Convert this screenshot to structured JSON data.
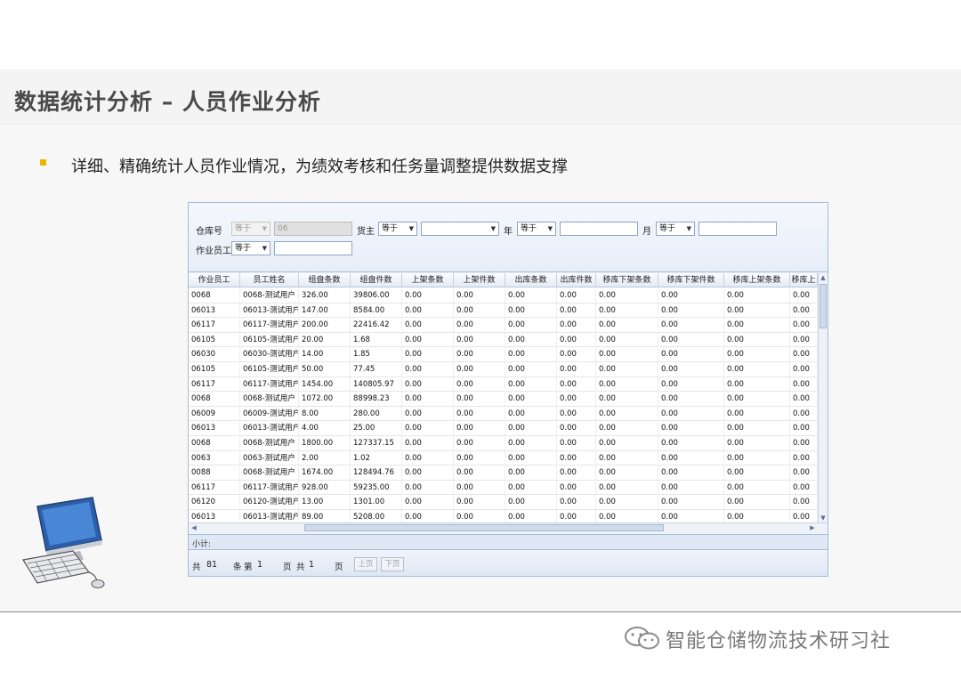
{
  "slide": {
    "title": "数据统计分析 – 人员作业分析",
    "bullet": "详细、精确统计人员作业情况，为绩效考核和任务量调整提供数据支撑",
    "accent_color": "#f0b400"
  },
  "filters": {
    "warehouse_label": "仓库号",
    "warehouse_op": "等于",
    "warehouse_value": "06",
    "owner_label": "货主",
    "owner_op": "等于",
    "owner_value": "",
    "year_label": "年",
    "year_op": "等于",
    "year_value": "",
    "month_label": "月",
    "month_op": "等于",
    "month_value": "",
    "worker_label": "作业员工",
    "worker_op": "等于",
    "worker_value": ""
  },
  "grid": {
    "columns": [
      "作业员工",
      "员工姓名",
      "组盘条数",
      "组盘件数",
      "上架条数",
      "上架件数",
      "出库条数",
      "出库件数",
      "移库下架条数",
      "移库下架件数",
      "移库上架条数",
      "移库上"
    ],
    "rows": [
      [
        "0068",
        "0068-测试用户",
        "326.00",
        "39806.00",
        "0.00",
        "0.00",
        "0.00",
        "0.00",
        "0.00",
        "0.00",
        "0.00",
        "0.00"
      ],
      [
        "06013",
        "06013-测试用户",
        "147.00",
        "8584.00",
        "0.00",
        "0.00",
        "0.00",
        "0.00",
        "0.00",
        "0.00",
        "0.00",
        "0.00"
      ],
      [
        "06117",
        "06117-测试用户",
        "200.00",
        "22416.42",
        "0.00",
        "0.00",
        "0.00",
        "0.00",
        "0.00",
        "0.00",
        "0.00",
        "0.00"
      ],
      [
        "06105",
        "06105-测试用户",
        "20.00",
        "1.68",
        "0.00",
        "0.00",
        "0.00",
        "0.00",
        "0.00",
        "0.00",
        "0.00",
        "0.00"
      ],
      [
        "06030",
        "06030-测试用户",
        "14.00",
        "1.85",
        "0.00",
        "0.00",
        "0.00",
        "0.00",
        "0.00",
        "0.00",
        "0.00",
        "0.00"
      ],
      [
        "06105",
        "06105-测试用户",
        "50.00",
        "77.45",
        "0.00",
        "0.00",
        "0.00",
        "0.00",
        "0.00",
        "0.00",
        "0.00",
        "0.00"
      ],
      [
        "06117",
        "06117-测试用户",
        "1454.00",
        "140805.97",
        "0.00",
        "0.00",
        "0.00",
        "0.00",
        "0.00",
        "0.00",
        "0.00",
        "0.00"
      ],
      [
        "0068",
        "0068-测试用户",
        "1072.00",
        "88998.23",
        "0.00",
        "0.00",
        "0.00",
        "0.00",
        "0.00",
        "0.00",
        "0.00",
        "0.00"
      ],
      [
        "06009",
        "06009-测试用户",
        "8.00",
        "280.00",
        "0.00",
        "0.00",
        "0.00",
        "0.00",
        "0.00",
        "0.00",
        "0.00",
        "0.00"
      ],
      [
        "06013",
        "06013-测试用户",
        "4.00",
        "25.00",
        "0.00",
        "0.00",
        "0.00",
        "0.00",
        "0.00",
        "0.00",
        "0.00",
        "0.00"
      ],
      [
        "0068",
        "0068-测试用户",
        "1800.00",
        "127337.15",
        "0.00",
        "0.00",
        "0.00",
        "0.00",
        "0.00",
        "0.00",
        "0.00",
        "0.00"
      ],
      [
        "0063",
        "0063-测试用户",
        "2.00",
        "1.02",
        "0.00",
        "0.00",
        "0.00",
        "0.00",
        "0.00",
        "0.00",
        "0.00",
        "0.00"
      ],
      [
        "0088",
        "0068-测试用户",
        "1674.00",
        "128494.76",
        "0.00",
        "0.00",
        "0.00",
        "0.00",
        "0.00",
        "0.00",
        "0.00",
        "0.00"
      ],
      [
        "06117",
        "06117-测试用户",
        "928.00",
        "59235.00",
        "0.00",
        "0.00",
        "0.00",
        "0.00",
        "0.00",
        "0.00",
        "0.00",
        "0.00"
      ],
      [
        "06120",
        "06120-测试用户",
        "13.00",
        "1301.00",
        "0.00",
        "0.00",
        "0.00",
        "0.00",
        "0.00",
        "0.00",
        "0.00",
        "0.00"
      ],
      [
        "06013",
        "06013-测试用户",
        "89.00",
        "5208.00",
        "0.00",
        "0.00",
        "0.00",
        "0.00",
        "0.00",
        "0.00",
        "0.00",
        "0.00"
      ]
    ]
  },
  "subtotal_label": "小计:",
  "pager": {
    "total_prefix": "共",
    "total_count": "81",
    "record_word": "条",
    "page_prefix": "第",
    "page_number": "1",
    "page_word": "页",
    "pages_prefix": "共",
    "pages_count": "1",
    "pages_word": "页",
    "prev_label": "上页",
    "next_label": "下页"
  },
  "watermark": {
    "text": "智能仓储物流技术研习社",
    "icon": "wechat-icon"
  },
  "decor": {
    "illustration_icon": "computer-icon"
  }
}
